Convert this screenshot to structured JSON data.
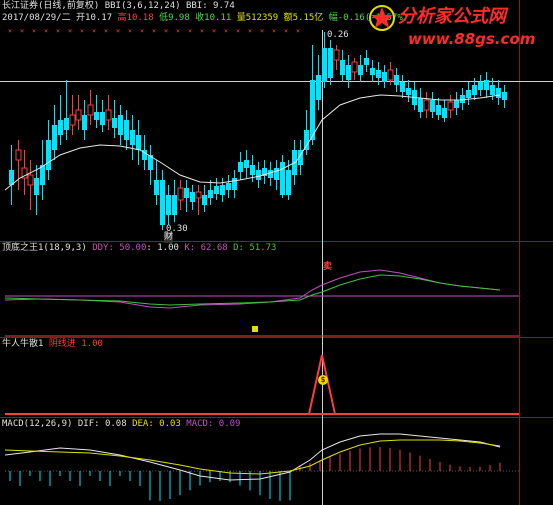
{
  "header": {
    "title": "长江证券(日线,前复权)",
    "bbi_params": "BBI(3,6,12,24)",
    "bbi_value": "BBI: 9.74",
    "date": "2017/08/29/二",
    "open": "开10.17",
    "high": "高10.18",
    "low": "低9.98",
    "close": "收10.11",
    "volume": "量512359",
    "amount": "额5.15亿",
    "change": "幅-0.16(-1.57%)"
  },
  "main_chart": {
    "high_label": "0.26",
    "low_label": "0.30",
    "finance_marker": "财"
  },
  "panel2": {
    "name": "顶底之王1(18,9,3)",
    "ddy": "DDY: 50.00",
    "ddy_val": ": 1.00",
    "k": "K: 62.68",
    "d": "D: 51.73",
    "signal_mark": "卖"
  },
  "panel3": {
    "name": "牛人牛散1",
    "line_label": "阴线进",
    "line_value": "1.00",
    "signal_mark": "$"
  },
  "panel4": {
    "name": "MACD(12,26,9)",
    "dif": "DIF: 0.08",
    "dea": "DEA: 0.03",
    "macd": "MACD: 0.09"
  },
  "watermark": {
    "brand": "分析家公式网",
    "url": "www.88gs.com"
  },
  "colors": {
    "up": "#ff3c3c",
    "down": "#00e5ff",
    "ma": "#e8e8e8",
    "purple": "#c050c0",
    "green": "#40c040",
    "yellow": "#e0e000",
    "brand": "#ff2a2a"
  }
}
